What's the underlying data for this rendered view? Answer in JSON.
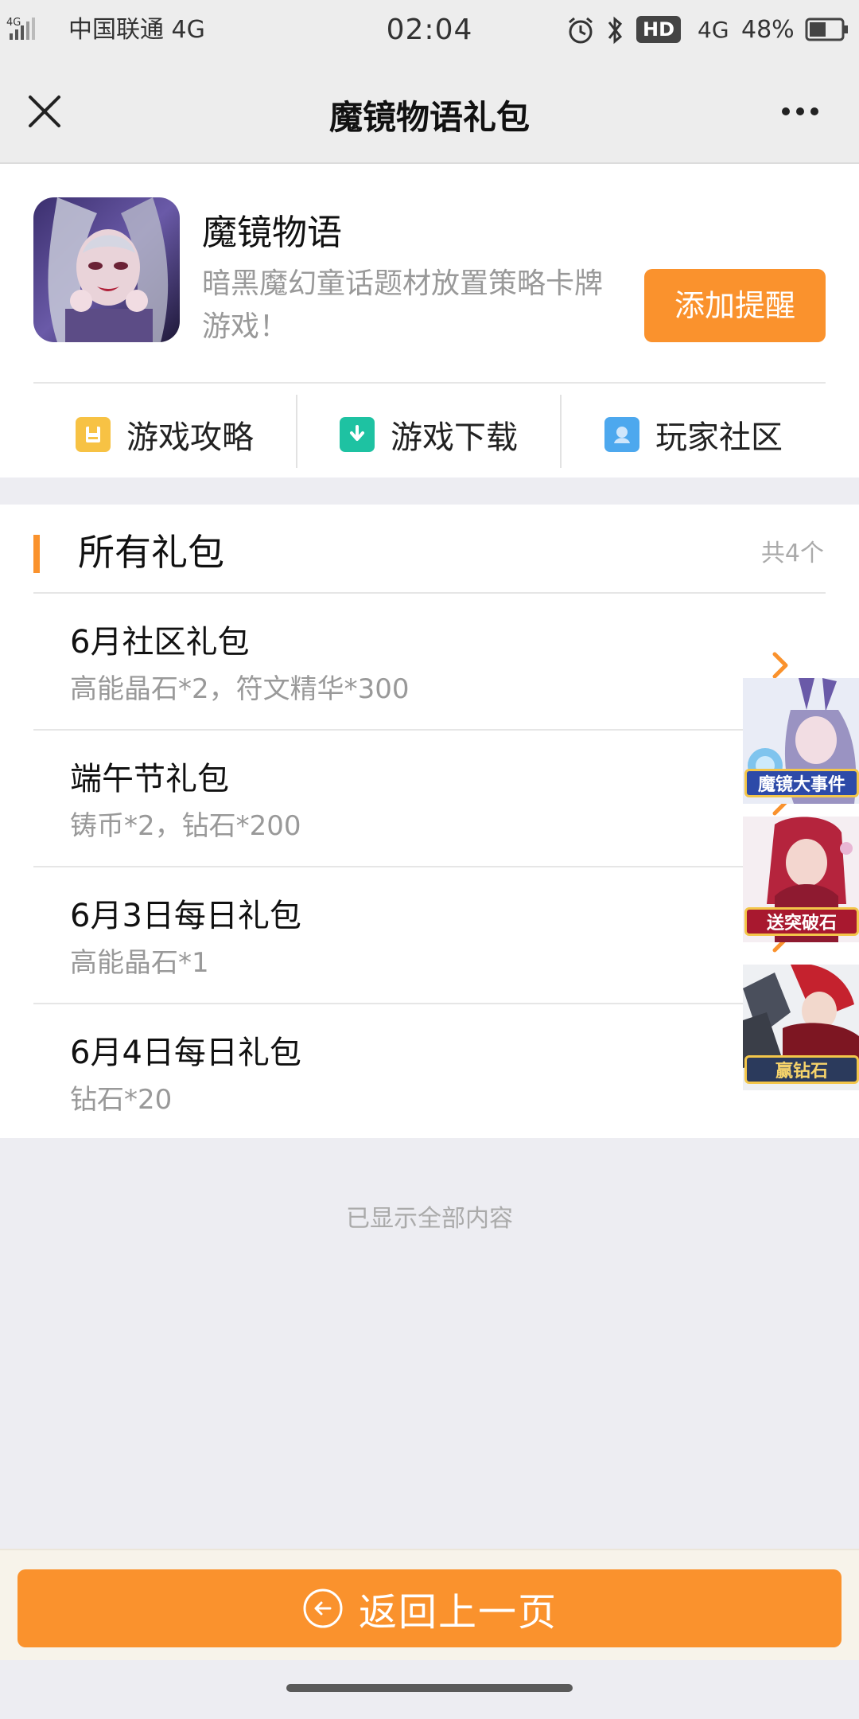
{
  "status_bar": {
    "signal_text": "4G",
    "carrier": "中国联通 4G",
    "time": "02:04",
    "hd_badge": "HD",
    "network": "4G",
    "battery": "48%"
  },
  "nav": {
    "title": "魔镜物语礼包",
    "close_icon": "close-icon",
    "more_icon": "more-icon"
  },
  "game": {
    "name": "魔镜物语",
    "description": "暗黑魔幻童话题材放置策略卡牌游戏！",
    "remind_button": "添加提醒"
  },
  "quick_links": [
    {
      "label": "游戏攻略",
      "icon": "guide-icon",
      "color": "#f7c244"
    },
    {
      "label": "游戏下载",
      "icon": "download-icon",
      "color": "#1ec2a2"
    },
    {
      "label": "玩家社区",
      "icon": "community-icon",
      "color": "#4da8ee"
    }
  ],
  "gifts": {
    "title": "所有礼包",
    "count": "共4个",
    "items": [
      {
        "name": "6月社区礼包",
        "reward": "高能晶石*2，符文精华*300"
      },
      {
        "name": "端午节礼包",
        "reward": "铸币*2，钻石*200"
      },
      {
        "name": "6月3日每日礼包",
        "reward": "高能晶石*1"
      },
      {
        "name": "6月4日每日礼包",
        "reward": "钻石*20"
      }
    ]
  },
  "promos": [
    {
      "label": "魔镜大事件"
    },
    {
      "label": "送突破石"
    },
    {
      "label": "赢钻石"
    }
  ],
  "footer_note": "已显示全部内容",
  "back_button": "返回上一页",
  "colors": {
    "accent": "#fa922d"
  }
}
